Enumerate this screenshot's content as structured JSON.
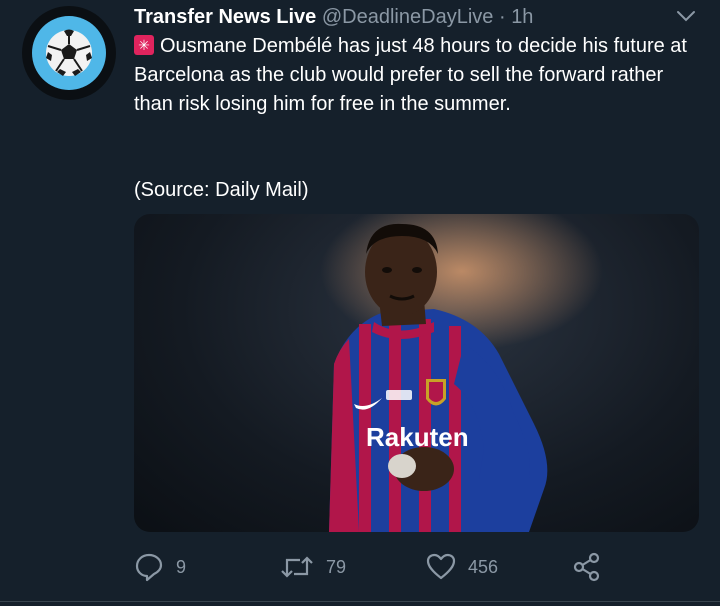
{
  "tweet": {
    "display_name": "Transfer News Live",
    "handle": "@DeadlineDayLive",
    "separator": "·",
    "time": "1h",
    "body": "Ousmane Dembélé has just 48 hours to decide his future at Barcelona as the club would prefer to sell the forward rather than risk losing him for free in the summer.",
    "source": "(Source: Daily Mail)",
    "emoji_icon": "rotating-light-icon",
    "media_alt": "Ousmane Dembélé in Barcelona kit",
    "media_text": {
      "sponsor": "Rakuten"
    }
  },
  "actions": {
    "reply_count": "9",
    "retweet_count": "79",
    "like_count": "456"
  },
  "colors": {
    "background": "#15202b",
    "muted": "#8b98a5",
    "avatar_accent": "#4fb7e8",
    "jersey_blue": "#1c3f9e",
    "jersey_red": "#b1164a"
  }
}
